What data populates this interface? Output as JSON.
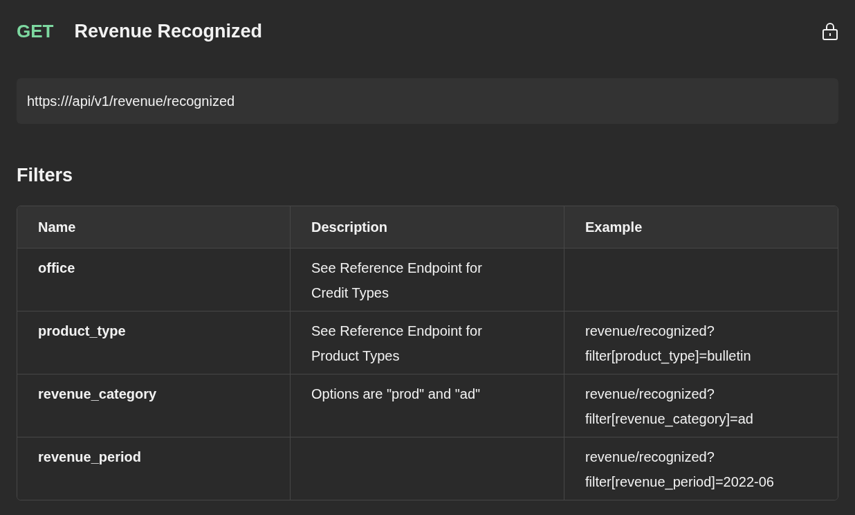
{
  "endpoint": {
    "method": "GET",
    "title": "Revenue Recognized",
    "locked": true,
    "url": "https:///api/v1/revenue/recognized"
  },
  "filters": {
    "heading": "Filters",
    "columns": [
      "Name",
      "Description",
      "Example"
    ],
    "rows": [
      {
        "name": "office",
        "description": [
          "See Reference Endpoint for",
          "Credit Types"
        ]
      },
      {
        "name": "product_type",
        "description": [
          "See Reference Endpoint for",
          "Product Types"
        ],
        "example": [
          "revenue/recognized?",
          "filter[product_type]=bulletin"
        ]
      },
      {
        "name": "revenue_category",
        "description": [
          "Options are \"prod\" and \"ad\""
        ],
        "example": [
          "revenue/recognized?",
          "filter[revenue_category]=ad"
        ]
      },
      {
        "name": "revenue_period",
        "example": [
          "revenue/recognized?",
          "filter[revenue_period]=2022-06"
        ]
      }
    ]
  }
}
